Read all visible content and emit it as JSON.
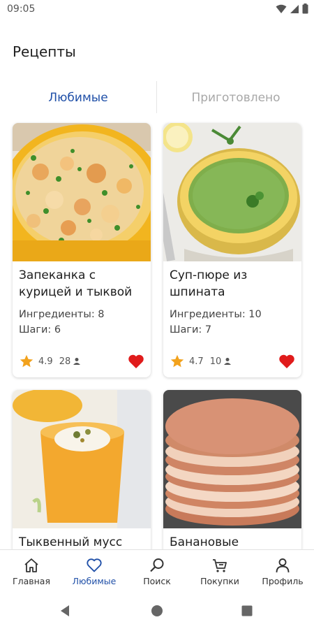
{
  "status_bar": {
    "time": "09:05",
    "icons": [
      "wifi-icon",
      "signal-icon",
      "battery-icon"
    ]
  },
  "header": {
    "title": "Рецепты"
  },
  "tabs": [
    {
      "label": "Любимые",
      "active": true
    },
    {
      "label": "Приготовлено",
      "active": false
    }
  ],
  "recipes": [
    {
      "title": "Запеканка с курицей и тыквой",
      "ingredients": "Ингредиенты: 8",
      "steps": "Шаги: 6",
      "rating": "4.9",
      "reviews": "28",
      "favorite": true
    },
    {
      "title": "Суп-пюре из шпината",
      "ingredients": "Ингредиенты: 10",
      "steps": "Шаги: 7",
      "rating": "4.7",
      "reviews": "10",
      "favorite": true
    },
    {
      "title": "Тыквенный мусс"
    },
    {
      "title": "Банановые"
    }
  ],
  "bottom_nav": [
    {
      "label": "Главная",
      "icon": "home-icon",
      "active": false
    },
    {
      "label": "Любимые",
      "icon": "heart-outline-icon",
      "active": true
    },
    {
      "label": "Поиск",
      "icon": "search-icon",
      "active": false
    },
    {
      "label": "Покупки",
      "icon": "cart-icon",
      "active": false
    },
    {
      "label": "Профиль",
      "icon": "profile-icon",
      "active": false
    }
  ],
  "system_nav": [
    "back-icon",
    "home-circle-icon",
    "recents-icon"
  ],
  "colors": {
    "accent": "#2050a8",
    "inactive_tab": "#a8a8a8",
    "favorite": "#e01b1b",
    "star": "#f2a21d"
  }
}
